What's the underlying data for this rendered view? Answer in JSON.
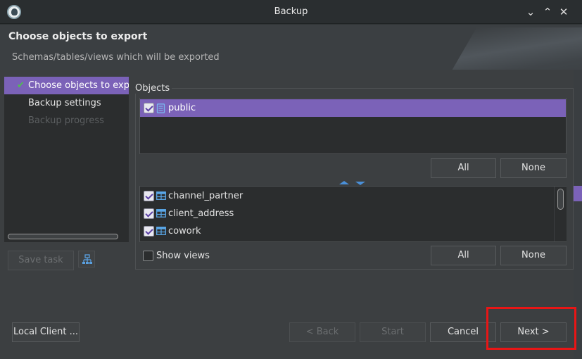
{
  "window": {
    "title": "Backup"
  },
  "header": {
    "title": "Choose objects to export",
    "subtitle": "Schemas/tables/views which will be exported"
  },
  "nav": {
    "items": [
      {
        "label": "Choose objects to export",
        "state": "current"
      },
      {
        "label": "Backup settings",
        "state": "enabled"
      },
      {
        "label": "Backup progress",
        "state": "disabled"
      }
    ]
  },
  "left_buttons": {
    "save_task": "Save task"
  },
  "objects": {
    "label": "Objects",
    "schemas": [
      {
        "name": "public",
        "checked": true
      }
    ],
    "schema_all": "All",
    "schema_none": "None",
    "tables": [
      {
        "name": "channel_partner",
        "checked": true
      },
      {
        "name": "client_address",
        "checked": true
      },
      {
        "name": "cowork",
        "checked": true
      }
    ],
    "show_views_label": "Show views",
    "show_views_checked": false,
    "table_all": "All",
    "table_none": "None"
  },
  "footer": {
    "local_client": "Local Client ...",
    "back": "< Back",
    "start": "Start",
    "cancel": "Cancel",
    "next": "Next >"
  },
  "colors": {
    "selection": "#7b62b8",
    "highlight": "#e81616",
    "check": "#4fbf4f"
  }
}
